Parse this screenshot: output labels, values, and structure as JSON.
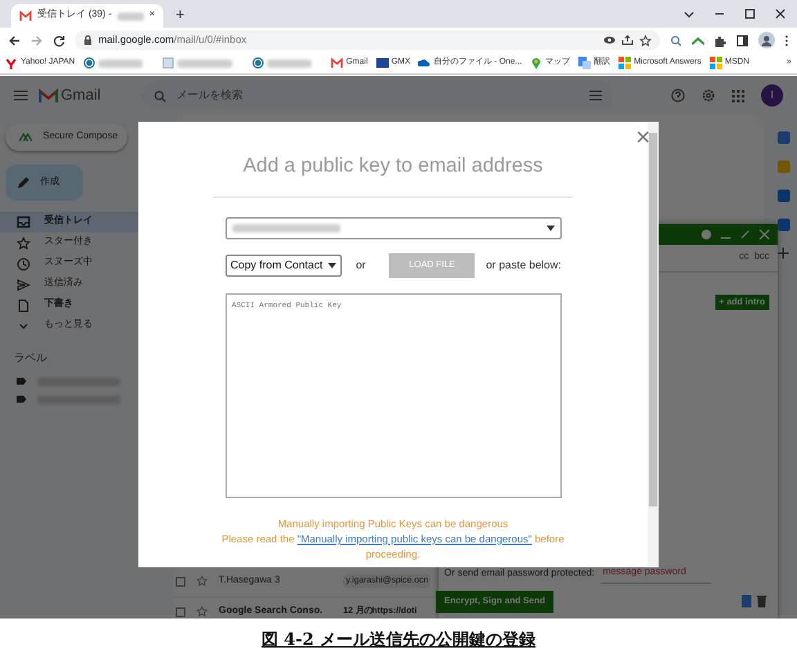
{
  "browser": {
    "tabs": [
      {
        "title": "受信トレイ (39) -",
        "selected": true
      }
    ],
    "new_tab": "+",
    "url": {
      "host": "mail.google.com",
      "path": "/mail/u/0/#inbox"
    },
    "tab_close": "×",
    "bookmarks": [
      {
        "kind": "link",
        "label": "Yahoo! JAPAN"
      },
      {
        "kind": "redacted"
      },
      {
        "kind": "redacted"
      },
      {
        "kind": "redacted"
      },
      {
        "kind": "link",
        "label": "Gmail"
      },
      {
        "kind": "link",
        "label": "GMX"
      },
      {
        "kind": "link",
        "label": "自分のファイル - One..."
      },
      {
        "kind": "link",
        "label": "マップ"
      },
      {
        "kind": "link",
        "label": "翻訳"
      },
      {
        "kind": "link",
        "label": "Microsoft Answers"
      },
      {
        "kind": "link",
        "label": "MSDN"
      }
    ],
    "more_bookmarks": "»"
  },
  "gmail": {
    "app_name": "Gmail",
    "search_placeholder": "メールを検索",
    "avatar": "I",
    "secure_compose": "Secure Compose",
    "compose": "作成",
    "nav": [
      {
        "label": "受信トレイ",
        "selected": true,
        "bold": true
      },
      {
        "label": "スター付き",
        "selected": false,
        "bold": false
      },
      {
        "label": "スヌーズ中",
        "selected": false,
        "bold": false
      },
      {
        "label": "送信済み",
        "selected": false,
        "bold": false
      },
      {
        "label": "下書き",
        "selected": false,
        "bold": true
      },
      {
        "label": "もっと見る",
        "selected": false,
        "bold": false
      }
    ],
    "labels_heading": "ラベル",
    "emails": [
      {
        "sender": "T.Hasegawa 3",
        "snippet": "y.igarashi@spice.ocn",
        "unread": false
      },
      {
        "sender": "Google Search Conso.",
        "snippet": "12 月のhttps://doti",
        "unread": true
      }
    ],
    "compose_panel": {
      "cc": "cc",
      "bcc": "bcc",
      "add_intro": "+ add intro",
      "password_label": "Or send email password protected:",
      "password_placeholder": "message password",
      "send": "Encrypt, Sign and Send"
    }
  },
  "modal": {
    "close": "×",
    "title": "Add a public key to email address",
    "source_select": "Copy from Contact",
    "or": "or",
    "load_file": "LOAD FILE",
    "paste": "or paste below:",
    "key_placeholder": "ASCII Armored Public Key",
    "warning": "Manually importing Public Keys can be dangerous",
    "note_before": "Please read the",
    "note_link": "\"Manually importing public keys can be dangerous\"",
    "note_after": "before proceeding."
  },
  "caption": "図 4-2 メール送信先の公開鍵の登録"
}
